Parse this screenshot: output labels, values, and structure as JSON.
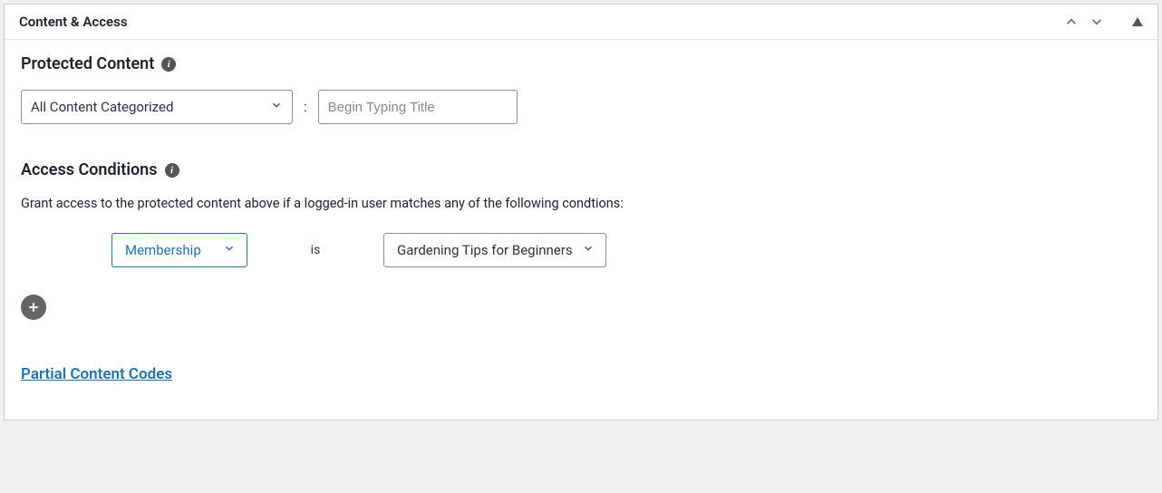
{
  "panel": {
    "title": "Content & Access"
  },
  "protected": {
    "heading": "Protected Content",
    "category_select": "All Content Categorized",
    "separator": ":",
    "title_placeholder": "Begin Typing Title"
  },
  "access": {
    "heading": "Access Conditions",
    "description": "Grant access to the protected content above if a logged-in user matches any of the following condtions:",
    "condition": {
      "type": "Membership",
      "operator": "is",
      "value": "Gardening Tips for Beginners"
    }
  },
  "link": {
    "label": "Partial Content Codes"
  }
}
